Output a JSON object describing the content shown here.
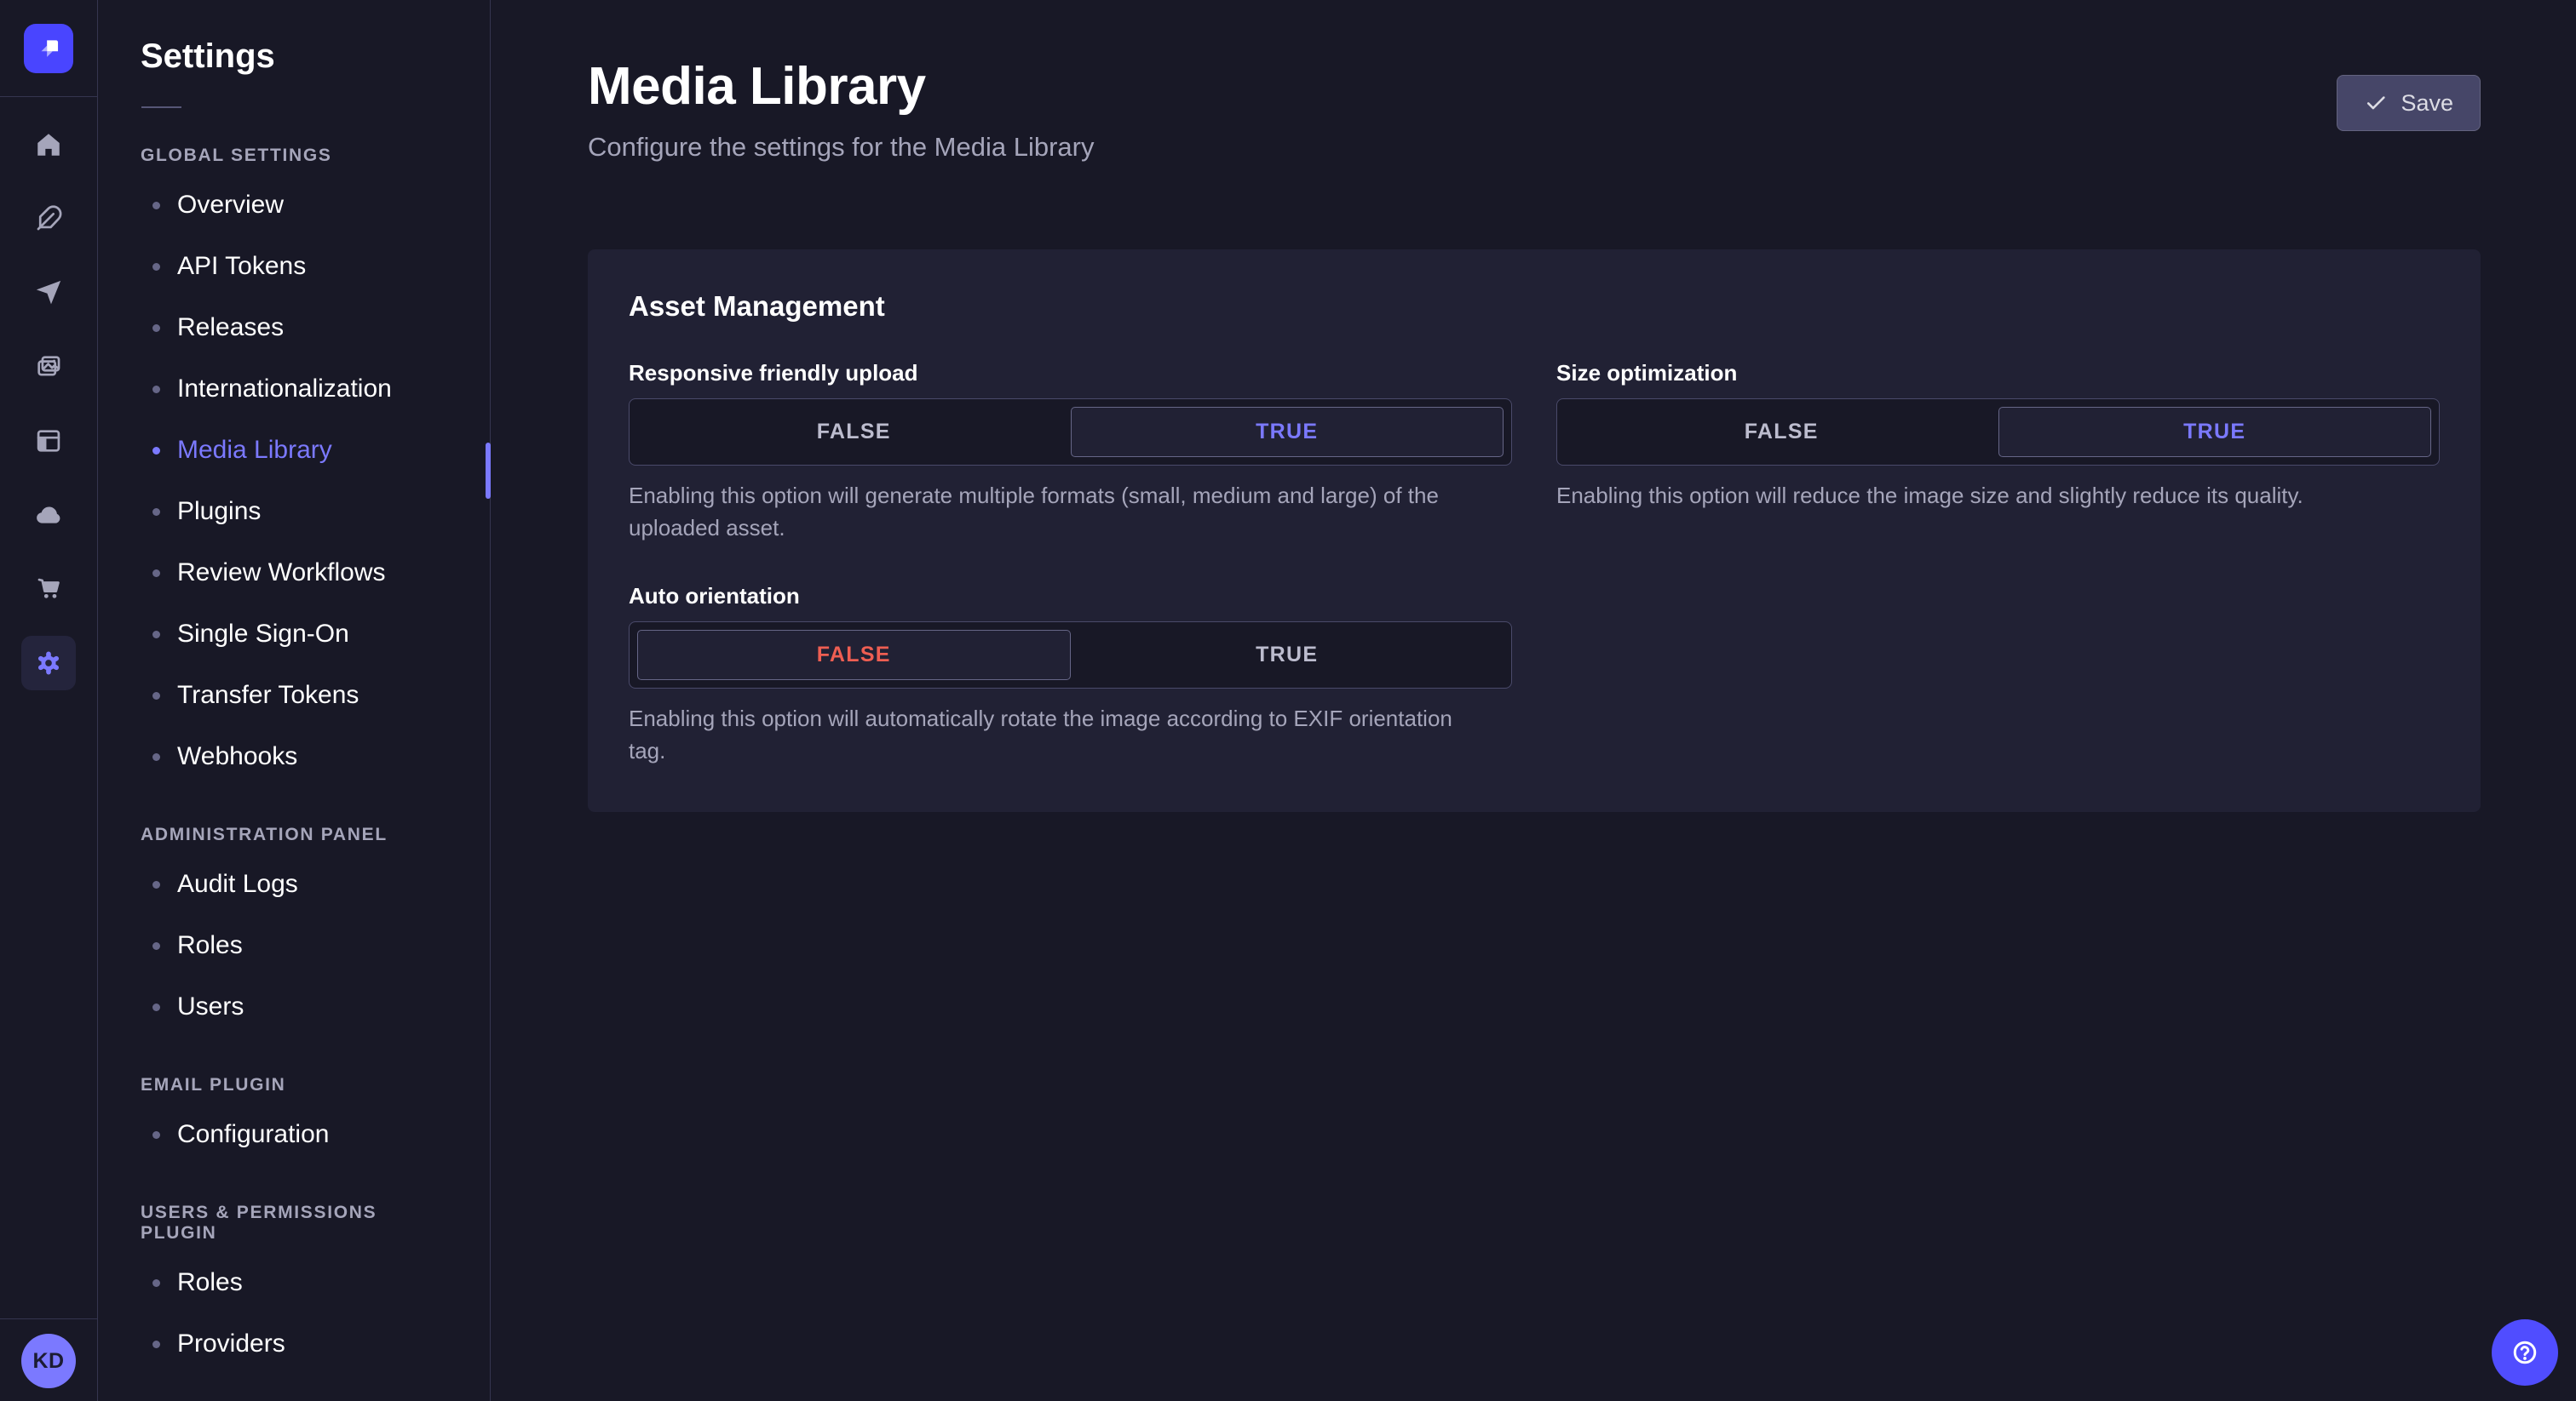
{
  "colors": {
    "app_background": "#181826",
    "surface": "#212134",
    "primary": "#4945ff",
    "primary_light": "#7b79ff",
    "danger": "#ee5e52",
    "muted_text": "#a5a5ba",
    "border": "#4a4a6a"
  },
  "icon_strip": {
    "logo_icon": "strapi-logo-icon",
    "items": [
      {
        "icon": "home-icon",
        "active": false
      },
      {
        "icon": "feather-icon",
        "active": false
      },
      {
        "icon": "paper-plane-icon",
        "active": false
      },
      {
        "icon": "images-icon",
        "active": false
      },
      {
        "icon": "layout-icon",
        "active": false
      },
      {
        "icon": "cloud-icon",
        "active": false
      },
      {
        "icon": "cart-icon",
        "active": false
      },
      {
        "icon": "gear-icon",
        "active": true
      }
    ],
    "avatar_initials": "KD"
  },
  "subnav": {
    "title": "Settings",
    "sections": [
      {
        "label": "GLOBAL SETTINGS",
        "items": [
          {
            "label": "Overview",
            "active": false
          },
          {
            "label": "API Tokens",
            "active": false
          },
          {
            "label": "Releases",
            "active": false
          },
          {
            "label": "Internationalization",
            "active": false
          },
          {
            "label": "Media Library",
            "active": true
          },
          {
            "label": "Plugins",
            "active": false
          },
          {
            "label": "Review Workflows",
            "active": false
          },
          {
            "label": "Single Sign-On",
            "active": false
          },
          {
            "label": "Transfer Tokens",
            "active": false
          },
          {
            "label": "Webhooks",
            "active": false
          }
        ]
      },
      {
        "label": "ADMINISTRATION PANEL",
        "items": [
          {
            "label": "Audit Logs",
            "active": false
          },
          {
            "label": "Roles",
            "active": false
          },
          {
            "label": "Users",
            "active": false
          }
        ]
      },
      {
        "label": "EMAIL PLUGIN",
        "items": [
          {
            "label": "Configuration",
            "active": false
          }
        ]
      },
      {
        "label": "USERS & PERMISSIONS PLUGIN",
        "items": [
          {
            "label": "Roles",
            "active": false
          },
          {
            "label": "Providers",
            "active": false
          }
        ]
      }
    ]
  },
  "header": {
    "title": "Media Library",
    "subtitle": "Configure the settings for the Media Library",
    "save_label": "Save"
  },
  "panel": {
    "title": "Asset Management",
    "fields": [
      {
        "label": "Responsive friendly upload",
        "off_label": "FALSE",
        "on_label": "TRUE",
        "value": "TRUE",
        "hint": "Enabling this option will generate multiple formats (small, medium and large) of the uploaded asset."
      },
      {
        "label": "Size optimization",
        "off_label": "FALSE",
        "on_label": "TRUE",
        "value": "TRUE",
        "hint": "Enabling this option will reduce the image size and slightly reduce its quality."
      },
      {
        "label": "Auto orientation",
        "off_label": "FALSE",
        "on_label": "TRUE",
        "value": "FALSE",
        "hint": "Enabling this option will automatically rotate the image according to EXIF orientation tag."
      }
    ]
  },
  "help": {
    "icon": "question-circle-icon"
  }
}
